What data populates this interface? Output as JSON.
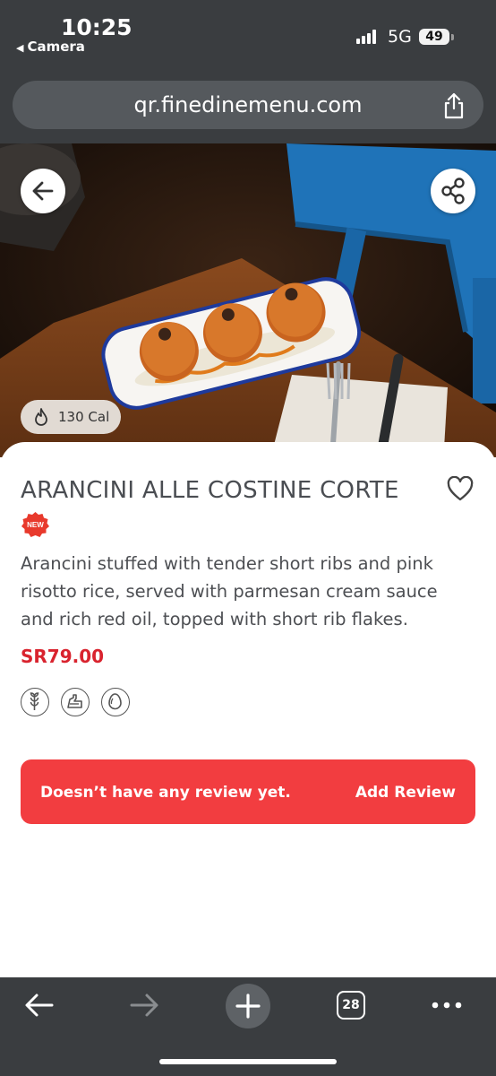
{
  "status": {
    "time": "10:25",
    "back_app": "Camera",
    "network": "5G",
    "battery": "49"
  },
  "browser": {
    "url": "qr.finedinemenu.com",
    "tabs_count": "28"
  },
  "item": {
    "calories": "130 Cal",
    "badge": "NEW",
    "title": "ARANCINI ALLE COSTINE CORTE",
    "description": "Arancini stuffed with tender short ribs and pink risotto rice, served with parmesan cream sauce and rich red oil, topped with short rib flakes.",
    "price": "SR79.00",
    "allergen_icons": [
      "wheat-icon",
      "dairy-icon",
      "egg-icon"
    ]
  },
  "reviews": {
    "empty_text": "Doesn’t have any review yet.",
    "add_label": "Add Review"
  },
  "colors": {
    "accent": "#f23d40",
    "price": "#d9232e",
    "chrome": "#3a3d40"
  }
}
